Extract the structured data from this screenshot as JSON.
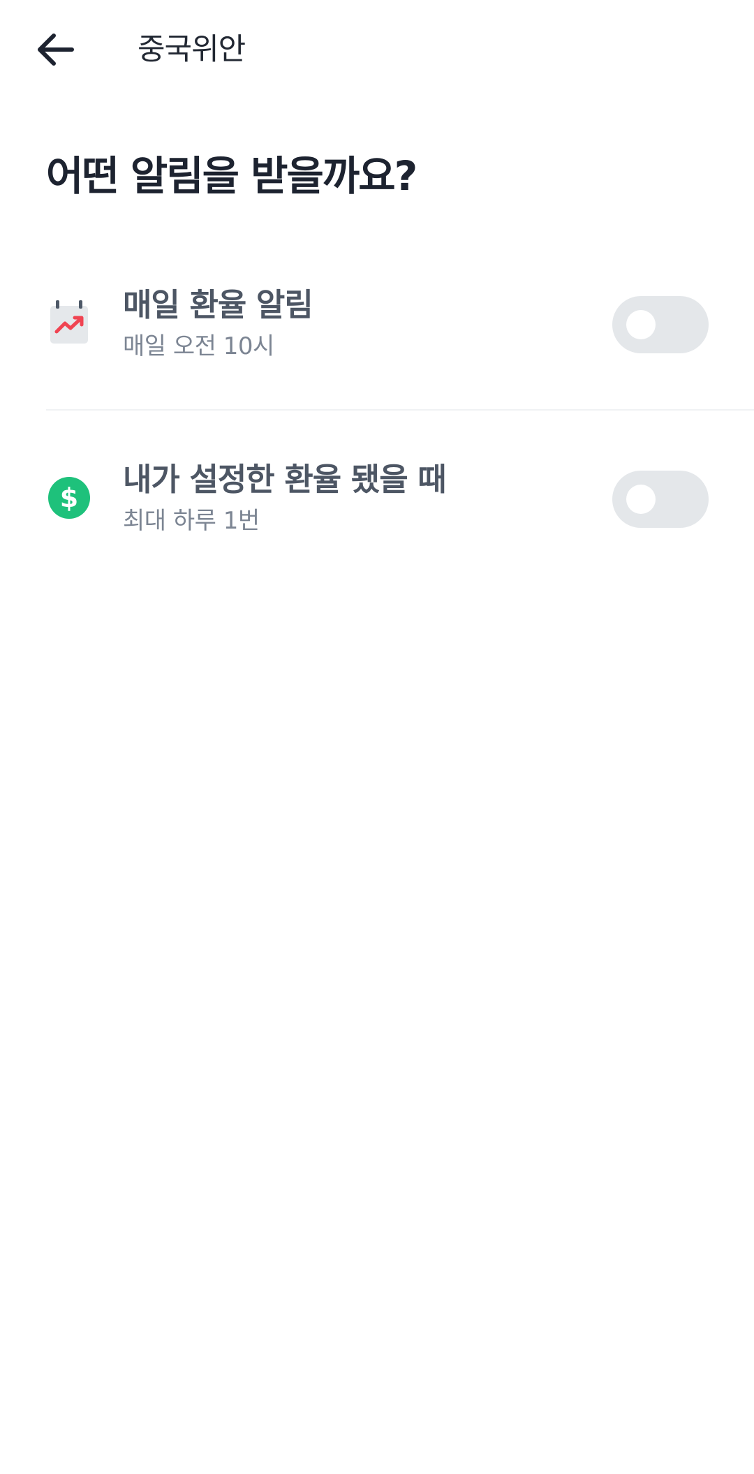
{
  "header": {
    "title": "중국위안",
    "back_icon": "arrow-left-icon"
  },
  "heading": "어떤 알림을 받을까요?",
  "settings": [
    {
      "icon": "calendar-trend-icon",
      "title": "매일 환율 알림",
      "subtitle": "매일 오전 10시",
      "enabled": false
    },
    {
      "icon": "dollar-circle-icon",
      "title": "내가 설정한 환율 됐을 때",
      "subtitle": "최대 하루 1번",
      "enabled": false
    }
  ],
  "colors": {
    "toggle_off": "#e4e7ea",
    "trend_red": "#f04452",
    "dollar_green": "#1ec17b",
    "divider": "#f0f2f4"
  }
}
